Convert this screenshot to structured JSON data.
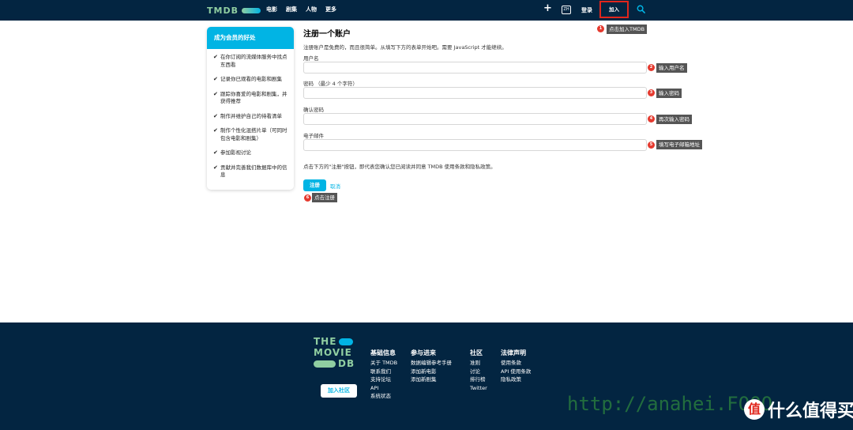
{
  "header": {
    "logo": "TMDB",
    "nav": [
      "电影",
      "剧集",
      "人物",
      "更多"
    ],
    "plus": "+",
    "lang": "ZH",
    "login": "登录",
    "join": "加入 TMDB",
    "search_icon": "search-icon"
  },
  "annotations": [
    {
      "num": "1",
      "text": "点击加入TMDB"
    },
    {
      "num": "2",
      "text": "输入用户名"
    },
    {
      "num": "3",
      "text": "输入密码"
    },
    {
      "num": "4",
      "text": "再次输入密码"
    },
    {
      "num": "5",
      "text": "填写电子邮箱地址"
    },
    {
      "num": "6",
      "text": "点击注册"
    }
  ],
  "sidebar": {
    "title": "成为会员的好处",
    "items": [
      "在你订阅的流媒体服务中找点东西看",
      "记录你已观看的电影和剧集",
      "跟踪你喜爱的电影和剧集，并获得推荐",
      "制作并维护自己的待看清单",
      "制作个性化混搭片单（可同时包含电影和剧集）",
      "参加影视讨论",
      "贡献并完善我们数据库中的信息"
    ]
  },
  "form": {
    "title": "注册一个账户",
    "intro": "注册账户是免费的，而且很简单。从填写下方的表单开始吧。需要 JavaScript 才能继续。",
    "username_label": "用户名",
    "password_label": "密码 （最少 4 个字符）",
    "confirm_label": "确认密码",
    "email_label": "电子邮件",
    "terms": "点击下方的\"注册\"按钮，即代表您确认您已阅读并同意 TMDB 使用条款和隐私政策。",
    "signup": "注册",
    "cancel": "取消"
  },
  "footer": {
    "logo_lines": [
      "THE",
      "MOVIE",
      "DB"
    ],
    "community_button": "加入社区",
    "columns": [
      {
        "title": "基础信息",
        "items": [
          "关于 TMDB",
          "联系我们",
          "支持论坛",
          "API",
          "系统状态"
        ]
      },
      {
        "title": "参与进来",
        "items": [
          "数据编辑参考手册",
          "添加新电影",
          "添加新剧集"
        ]
      },
      {
        "title": "社区",
        "items": [
          "准则",
          "讨论",
          "排行榜",
          "Twitter"
        ]
      },
      {
        "title": "法律声明",
        "items": [
          "使用条款",
          "API 使用条款",
          "隐私政策"
        ]
      }
    ]
  },
  "watermark": {
    "url": "http://anahei.FOOO",
    "brand_icon": "值",
    "brand": "什么值得买"
  },
  "colors": {
    "navy": "#032541",
    "accent": "#01b4e4",
    "green": "#90cea1",
    "highlight": "#e0261c"
  }
}
